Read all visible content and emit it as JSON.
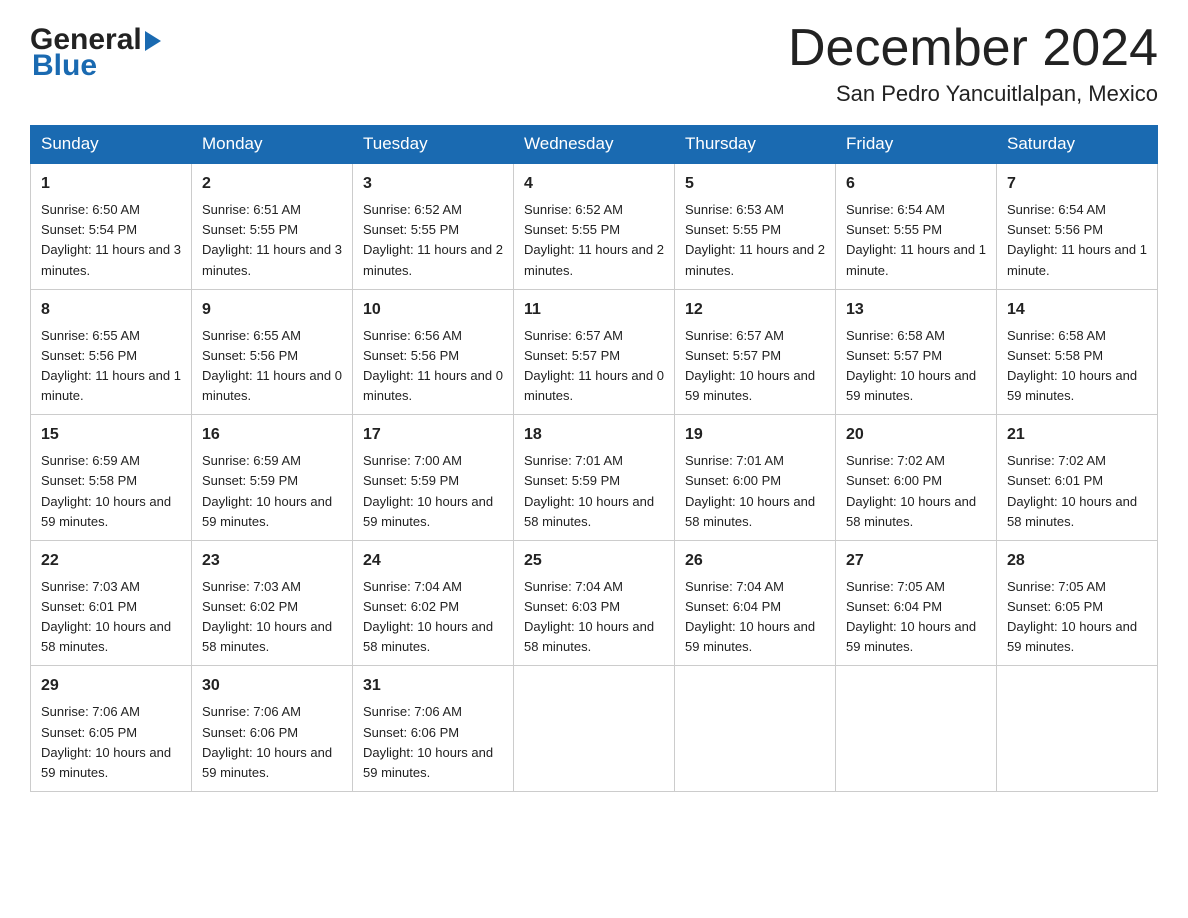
{
  "header": {
    "logo_general": "General",
    "logo_blue": "Blue",
    "month_title": "December 2024",
    "location": "San Pedro Yancuitlalpan, Mexico"
  },
  "days_of_week": [
    "Sunday",
    "Monday",
    "Tuesday",
    "Wednesday",
    "Thursday",
    "Friday",
    "Saturday"
  ],
  "weeks": [
    [
      {
        "day": "1",
        "sunrise": "6:50 AM",
        "sunset": "5:54 PM",
        "daylight": "11 hours and 3 minutes."
      },
      {
        "day": "2",
        "sunrise": "6:51 AM",
        "sunset": "5:55 PM",
        "daylight": "11 hours and 3 minutes."
      },
      {
        "day": "3",
        "sunrise": "6:52 AM",
        "sunset": "5:55 PM",
        "daylight": "11 hours and 2 minutes."
      },
      {
        "day": "4",
        "sunrise": "6:52 AM",
        "sunset": "5:55 PM",
        "daylight": "11 hours and 2 minutes."
      },
      {
        "day": "5",
        "sunrise": "6:53 AM",
        "sunset": "5:55 PM",
        "daylight": "11 hours and 2 minutes."
      },
      {
        "day": "6",
        "sunrise": "6:54 AM",
        "sunset": "5:55 PM",
        "daylight": "11 hours and 1 minute."
      },
      {
        "day": "7",
        "sunrise": "6:54 AM",
        "sunset": "5:56 PM",
        "daylight": "11 hours and 1 minute."
      }
    ],
    [
      {
        "day": "8",
        "sunrise": "6:55 AM",
        "sunset": "5:56 PM",
        "daylight": "11 hours and 1 minute."
      },
      {
        "day": "9",
        "sunrise": "6:55 AM",
        "sunset": "5:56 PM",
        "daylight": "11 hours and 0 minutes."
      },
      {
        "day": "10",
        "sunrise": "6:56 AM",
        "sunset": "5:56 PM",
        "daylight": "11 hours and 0 minutes."
      },
      {
        "day": "11",
        "sunrise": "6:57 AM",
        "sunset": "5:57 PM",
        "daylight": "11 hours and 0 minutes."
      },
      {
        "day": "12",
        "sunrise": "6:57 AM",
        "sunset": "5:57 PM",
        "daylight": "10 hours and 59 minutes."
      },
      {
        "day": "13",
        "sunrise": "6:58 AM",
        "sunset": "5:57 PM",
        "daylight": "10 hours and 59 minutes."
      },
      {
        "day": "14",
        "sunrise": "6:58 AM",
        "sunset": "5:58 PM",
        "daylight": "10 hours and 59 minutes."
      }
    ],
    [
      {
        "day": "15",
        "sunrise": "6:59 AM",
        "sunset": "5:58 PM",
        "daylight": "10 hours and 59 minutes."
      },
      {
        "day": "16",
        "sunrise": "6:59 AM",
        "sunset": "5:59 PM",
        "daylight": "10 hours and 59 minutes."
      },
      {
        "day": "17",
        "sunrise": "7:00 AM",
        "sunset": "5:59 PM",
        "daylight": "10 hours and 59 minutes."
      },
      {
        "day": "18",
        "sunrise": "7:01 AM",
        "sunset": "5:59 PM",
        "daylight": "10 hours and 58 minutes."
      },
      {
        "day": "19",
        "sunrise": "7:01 AM",
        "sunset": "6:00 PM",
        "daylight": "10 hours and 58 minutes."
      },
      {
        "day": "20",
        "sunrise": "7:02 AM",
        "sunset": "6:00 PM",
        "daylight": "10 hours and 58 minutes."
      },
      {
        "day": "21",
        "sunrise": "7:02 AM",
        "sunset": "6:01 PM",
        "daylight": "10 hours and 58 minutes."
      }
    ],
    [
      {
        "day": "22",
        "sunrise": "7:03 AM",
        "sunset": "6:01 PM",
        "daylight": "10 hours and 58 minutes."
      },
      {
        "day": "23",
        "sunrise": "7:03 AM",
        "sunset": "6:02 PM",
        "daylight": "10 hours and 58 minutes."
      },
      {
        "day": "24",
        "sunrise": "7:04 AM",
        "sunset": "6:02 PM",
        "daylight": "10 hours and 58 minutes."
      },
      {
        "day": "25",
        "sunrise": "7:04 AM",
        "sunset": "6:03 PM",
        "daylight": "10 hours and 58 minutes."
      },
      {
        "day": "26",
        "sunrise": "7:04 AM",
        "sunset": "6:04 PM",
        "daylight": "10 hours and 59 minutes."
      },
      {
        "day": "27",
        "sunrise": "7:05 AM",
        "sunset": "6:04 PM",
        "daylight": "10 hours and 59 minutes."
      },
      {
        "day": "28",
        "sunrise": "7:05 AM",
        "sunset": "6:05 PM",
        "daylight": "10 hours and 59 minutes."
      }
    ],
    [
      {
        "day": "29",
        "sunrise": "7:06 AM",
        "sunset": "6:05 PM",
        "daylight": "10 hours and 59 minutes."
      },
      {
        "day": "30",
        "sunrise": "7:06 AM",
        "sunset": "6:06 PM",
        "daylight": "10 hours and 59 minutes."
      },
      {
        "day": "31",
        "sunrise": "7:06 AM",
        "sunset": "6:06 PM",
        "daylight": "10 hours and 59 minutes."
      },
      null,
      null,
      null,
      null
    ]
  ],
  "labels": {
    "sunrise": "Sunrise:",
    "sunset": "Sunset:",
    "daylight": "Daylight:"
  }
}
